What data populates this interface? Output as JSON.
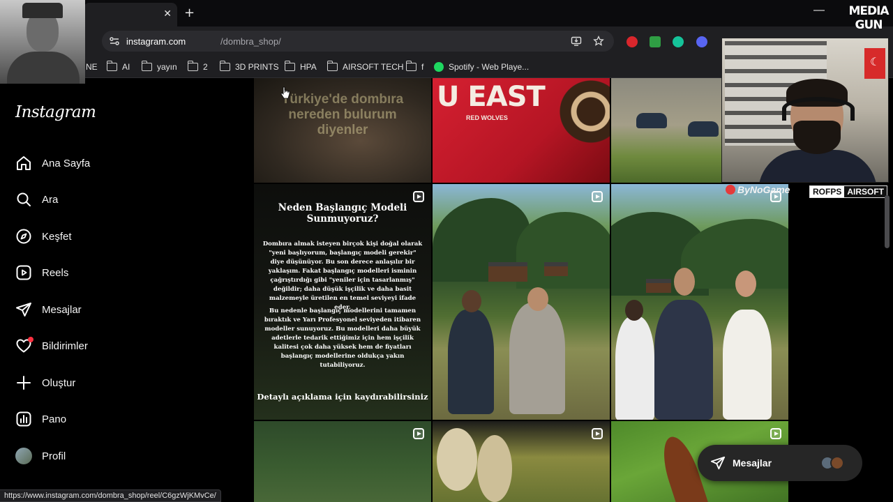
{
  "browser": {
    "tab_close": "✕",
    "new_tab": "+",
    "minimize": "—",
    "url_host": "instagram.com",
    "url_path": "/dombra_shop/",
    "status_url": "https://www.instagram.com/dombra_shop/reel/C6gzWjKMvCe/",
    "bookmarks": [
      "NE",
      "AI",
      "yayın",
      "2",
      "3D PRINTS",
      "HPA",
      "AIRSOFT TECH",
      "f",
      "Spotify - Web Playe..."
    ]
  },
  "overlay": {
    "logo_line1": "MEDIA",
    "logo_line2": "GUN",
    "sponsor_1": "ByNoGame",
    "sponsor_2a": "ROFPS",
    "sponsor_2b": "AIRSOFT"
  },
  "sidebar": {
    "logo": "Instagram",
    "items": [
      {
        "label": "Ana Sayfa",
        "icon": "home-icon"
      },
      {
        "label": "Ara",
        "icon": "search-icon"
      },
      {
        "label": "Keşfet",
        "icon": "compass-icon"
      },
      {
        "label": "Reels",
        "icon": "reels-icon"
      },
      {
        "label": "Mesajlar",
        "icon": "send-icon"
      },
      {
        "label": "Bildirimler",
        "icon": "heart-icon"
      },
      {
        "label": "Oluştur",
        "icon": "plus-icon"
      },
      {
        "label": "Pano",
        "icon": "dashboard-icon"
      },
      {
        "label": "Profil",
        "icon": "profile-avatar"
      }
    ]
  },
  "posts": {
    "p1_text_line1": "Türkiye'de dombıra",
    "p1_text_line2": "nereden bulurum",
    "p1_text_line3": "diyenler",
    "p2_text": "U EAST",
    "p2_sub": "RED WOLVES",
    "p4_title": "Neden Başlangıç Modeli Sunmuyoruz?",
    "p4_para1": "Dombıra almak isteyen birçok kişi doğal olarak \"yeni başlıyorum, başlangıç modeli gerekir\" diye düşünüyor. Bu son derece anlaşılır bir yaklaşım. Fakat başlangıç modelleri isminin çağrıştırdığı gibi \"yeniler için tasarlanmış\" değildir; daha düşük işçilik ve daha basit malzemeyle üretilen en temel seviyeyi ifade eder.",
    "p4_para2": "Bu nedenle başlangıç modellerini tamamen bıraktık ve Yarı Profesyonel seviyeden itibaren modeller sunuyoruz. Bu modelleri daha büyük adetlerle tedarik ettiğimiz için hem işçilik kalitesi çok daha yüksek hem de fiyatları başlangıç modellerine oldukça yakın tutabiliyoruz.",
    "p4_footer": "Detaylı açıklama için kaydırabilirsiniz"
  },
  "messages_pill": {
    "label": "Mesajlar"
  },
  "colors": {
    "accent_badge": "#ff3040",
    "spotify": "#1ed760",
    "background": "#000000"
  }
}
